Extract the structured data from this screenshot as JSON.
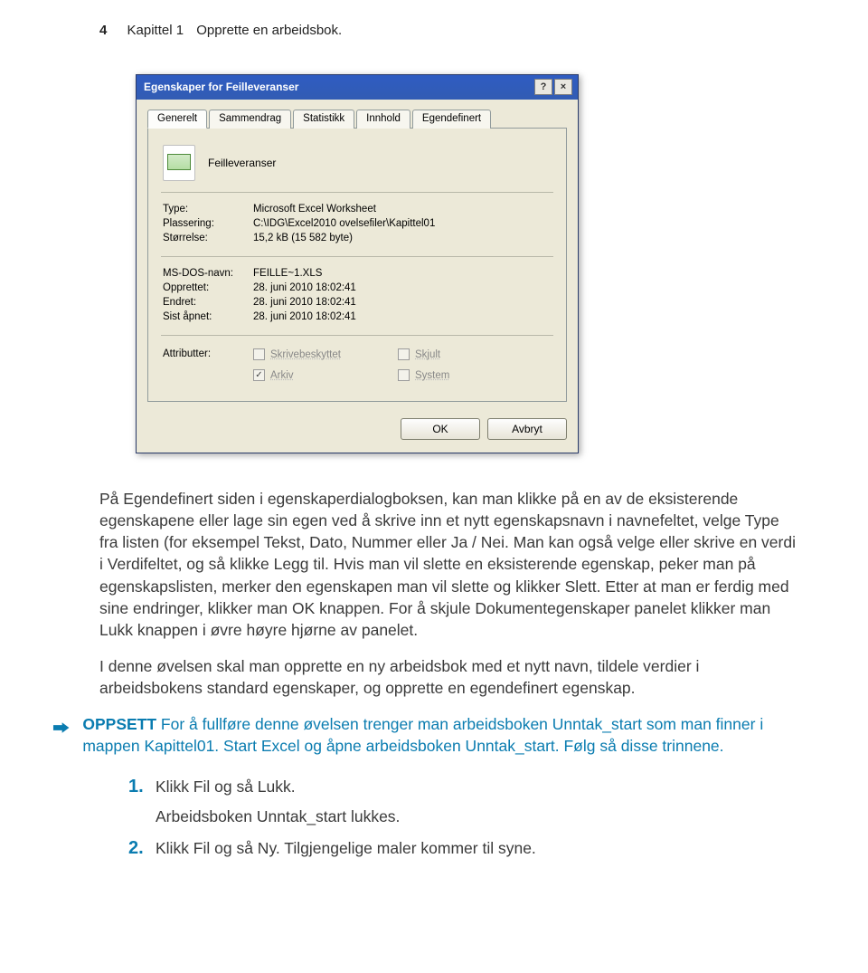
{
  "page": {
    "number": "4",
    "chapter": "Kapittel 1",
    "title": "Opprette en arbeidsbok."
  },
  "dialog": {
    "title": "Egenskaper for Feilleveranser",
    "help_btn": "?",
    "close_btn": "×",
    "tabs": [
      "Generelt",
      "Sammendrag",
      "Statistikk",
      "Innhold",
      "Egendefinert"
    ],
    "file_name": "Feilleveranser",
    "info1": {
      "type_label": "Type:",
      "type_value": "Microsoft Excel Worksheet",
      "location_label": "Plassering:",
      "location_value": "C:\\IDG\\Excel2010 ovelsefiler\\Kapittel01",
      "size_label": "Størrelse:",
      "size_value": "15,2 kB (15 582 byte)"
    },
    "info2": {
      "dos_label": "MS-DOS-navn:",
      "dos_value": "FEILLE~1.XLS",
      "created_label": "Opprettet:",
      "created_value": "28. juni 2010 18:02:41",
      "modified_label": "Endret:",
      "modified_value": "28. juni 2010 18:02:41",
      "opened_label": "Sist åpnet:",
      "opened_value": "28. juni 2010 18:02:41"
    },
    "attr": {
      "label": "Attributter:",
      "readonly": "Skrivebeskyttet",
      "hidden": "Skjult",
      "archive": "Arkiv",
      "system": "System"
    },
    "buttons": {
      "ok": "OK",
      "cancel": "Avbryt"
    }
  },
  "paragraphs": {
    "p1": "På Egendefinert siden i egenskaperdialogboksen, kan man klikke på en av de eksisterende egenskapene eller lage sin egen ved å skrive inn et nytt egenskapsnavn i navnefeltet, velge Type fra listen (for eksempel Tekst, Dato, Nummer eller Ja / Nei. Man kan også velge eller skrive en verdi i Verdifeltet, og så klikke Legg til. Hvis man vil slette en eksisterende egenskap, peker man på egenskapslisten, merker den egenskapen man vil slette og klikker Slett. Etter at man er ferdig med sine endringer, klikker man OK knappen. For å skjule Dokumentegenskaper panelet klikker man Lukk knappen i øvre høyre hjørne av panelet.",
    "p2": "I denne øvelsen skal man opprette en ny arbeidsbok med et nytt navn, tildele verdier i arbeidsbokens standard egenskaper, og opprette en egendefinert egenskap."
  },
  "callout": {
    "lead": "OPPSETT",
    "text": " For å fullføre denne øvelsen trenger man arbeidsboken Unntak_start som man finner i mappen Kapittel01. Start Excel og åpne arbeidsboken Unntak_start. Følg så disse trinnene."
  },
  "steps": {
    "s1_num": "1.",
    "s1": "Klikk Fil og så Lukk.",
    "s1_sub": "Arbeidsboken Unntak_start lukkes.",
    "s2_num": "2.",
    "s2": "Klikk Fil og så Ny. Tilgjengelige maler kommer til syne."
  }
}
